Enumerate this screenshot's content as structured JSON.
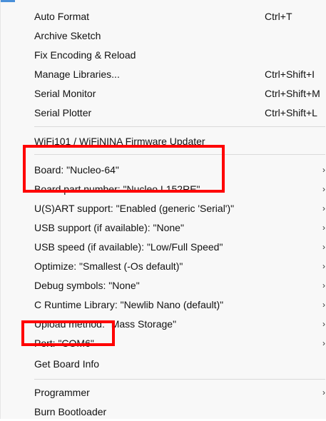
{
  "menu": {
    "group1": [
      {
        "label": "Auto Format",
        "shortcut": "Ctrl+T"
      },
      {
        "label": "Archive Sketch",
        "shortcut": ""
      },
      {
        "label": "Fix Encoding & Reload",
        "shortcut": ""
      },
      {
        "label": "Manage Libraries...",
        "shortcut": "Ctrl+Shift+I"
      },
      {
        "label": "Serial Monitor",
        "shortcut": "Ctrl+Shift+M"
      },
      {
        "label": "Serial Plotter",
        "shortcut": "Ctrl+Shift+L"
      }
    ],
    "group2": [
      {
        "label": "WiFi101 / WiFiNINA Firmware Updater"
      }
    ],
    "group3": [
      {
        "label": "Board: \"Nucleo-64\"",
        "submenu": true
      },
      {
        "label": "Board part number: \"Nucleo L152RE\"",
        "submenu": true
      },
      {
        "label": "U(S)ART support: \"Enabled (generic 'Serial')\"",
        "submenu": true
      },
      {
        "label": "USB support (if available): \"None\"",
        "submenu": true
      },
      {
        "label": "USB speed (if available): \"Low/Full Speed\"",
        "submenu": true
      },
      {
        "label": "Optimize: \"Smallest (-Os default)\"",
        "submenu": true
      },
      {
        "label": "Debug symbols: \"None\"",
        "submenu": true
      },
      {
        "label": "C Runtime Library: \"Newlib Nano (default)\"",
        "submenu": true
      },
      {
        "label": "Upload method: \"Mass Storage\"",
        "submenu": true
      },
      {
        "label": "Port: \"COM6\"",
        "submenu": true
      },
      {
        "label": "Get Board Info",
        "submenu": false
      }
    ],
    "group4": [
      {
        "label": "Programmer",
        "submenu": true
      },
      {
        "label": "Burn Bootloader",
        "submenu": false
      }
    ],
    "submenu_arrow": "›"
  },
  "colors": {
    "menu_bg": "#f8f8f8",
    "highlight": "#ff0000",
    "separator": "#dadada"
  }
}
